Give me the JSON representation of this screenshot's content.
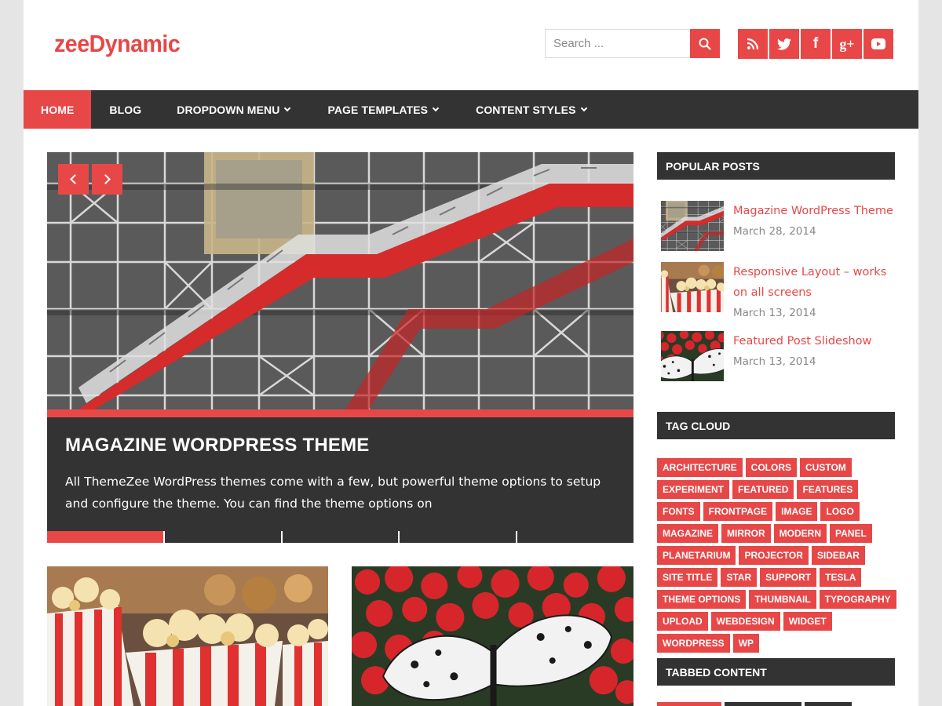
{
  "site": {
    "title": "zeeDynamic"
  },
  "search": {
    "placeholder": "Search ..."
  },
  "social": [
    {
      "icon": "rss-icon"
    },
    {
      "icon": "twitter-icon"
    },
    {
      "icon": "facebook-icon",
      "glyph": "f"
    },
    {
      "icon": "google-plus-icon",
      "glyph": "g+"
    },
    {
      "icon": "youtube-icon"
    }
  ],
  "nav": [
    {
      "label": "HOME",
      "active": true
    },
    {
      "label": "BLOG"
    },
    {
      "label": "DROPDOWN MENU",
      "dropdown": true
    },
    {
      "label": "PAGE TEMPLATES",
      "dropdown": true
    },
    {
      "label": "CONTENT STYLES",
      "dropdown": true
    }
  ],
  "slider": {
    "title": "MAGAZINE WORDPRESS THEME",
    "excerpt": "All ThemeZee WordPress themes come with a few, but powerful theme options to setup and configure the theme. You can find the theme options on",
    "slide_count": 5,
    "active_slide": 1
  },
  "sidebar": {
    "popular_title": "POPULAR POSTS",
    "popular": [
      {
        "title": "Magazine WordPress Theme",
        "date": "March 28, 2014",
        "thumb": "building"
      },
      {
        "title": "Responsive Layout – works on all screens",
        "date": "March 13, 2014",
        "thumb": "popcorn"
      },
      {
        "title": "Featured Post Slideshow",
        "date": "March 13, 2014",
        "thumb": "butterfly"
      }
    ],
    "tag_title": "TAG CLOUD",
    "tags": [
      "ARCHITECTURE",
      "COLORS",
      "CUSTOM",
      "EXPERIMENT",
      "FEATURED",
      "FEATURES",
      "FONTS",
      "FRONTPAGE",
      "IMAGE",
      "LOGO",
      "MAGAZINE",
      "MIRROR",
      "MODERN",
      "PANEL",
      "PLANETARIUM",
      "PROJECTOR",
      "SIDEBAR",
      "SITE TITLE",
      "STAR",
      "SUPPORT",
      "TESLA",
      "THEME OPTIONS",
      "THUMBNAIL",
      "TYPOGRAPHY",
      "UPLOAD",
      "WEBDESIGN",
      "WIDGET",
      "WORDPRESS",
      "WP"
    ],
    "tabbed_title": "TABBED CONTENT"
  },
  "colors": {
    "accent": "#e84747",
    "dark": "#333333",
    "muted": "#888888"
  }
}
